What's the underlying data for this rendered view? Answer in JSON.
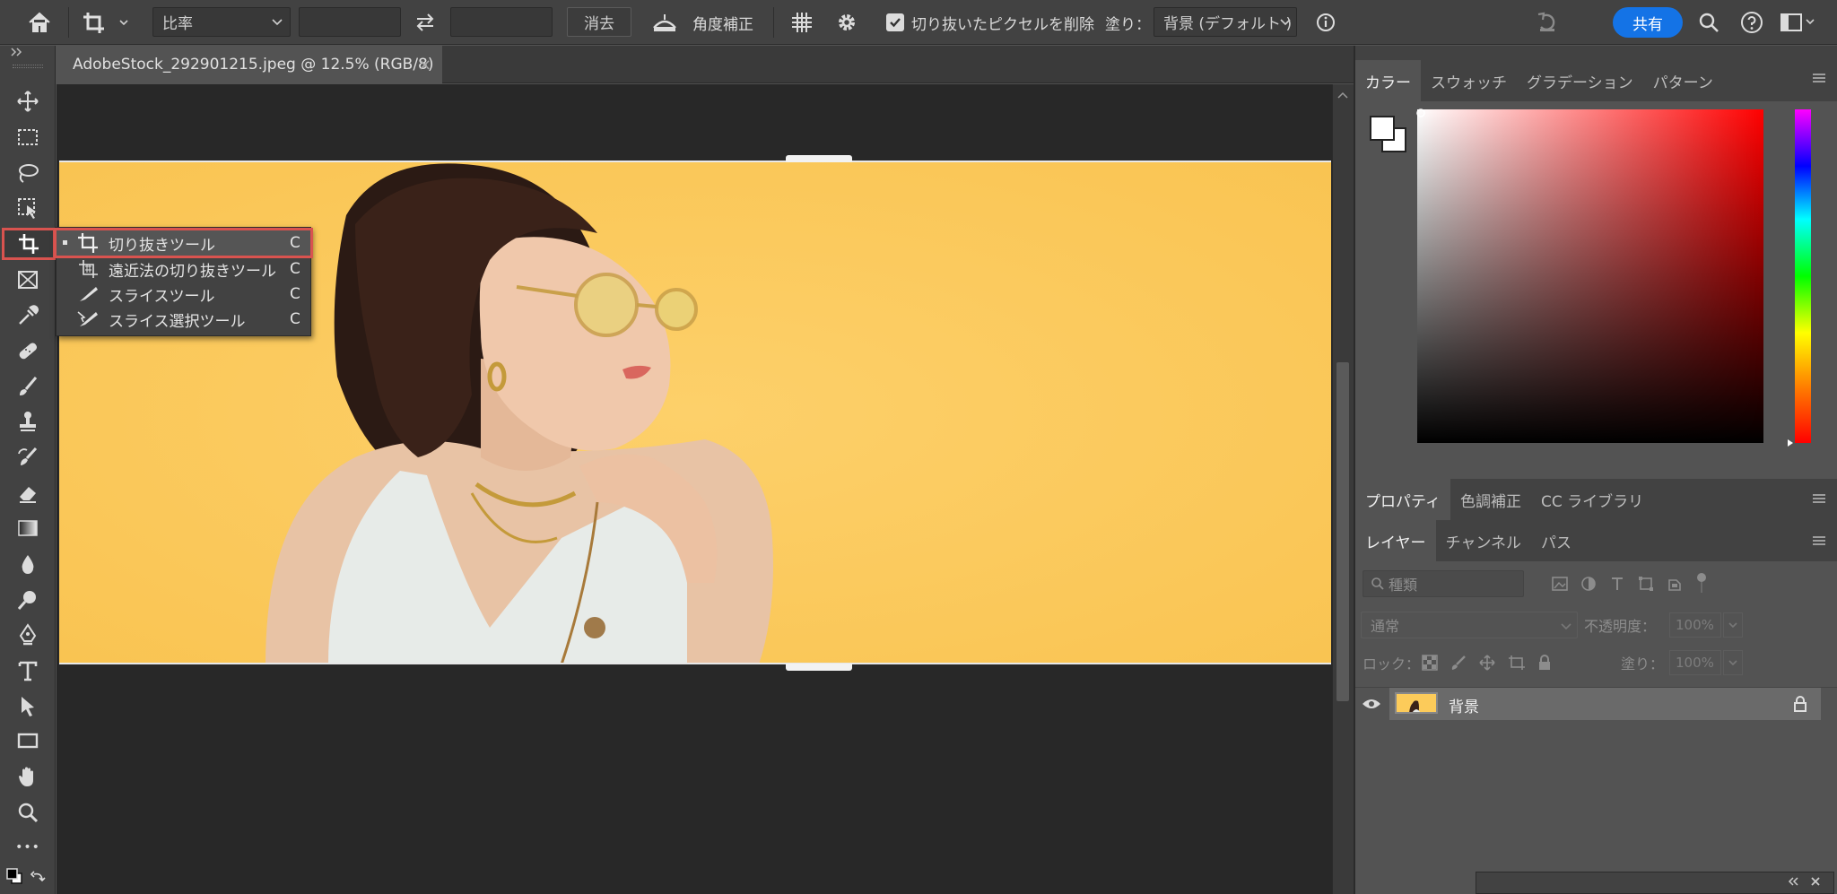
{
  "options_bar": {
    "ratio_label": "比率",
    "width_value": "",
    "height_value": "",
    "clear_label": "消去",
    "straighten_label": "角度補正",
    "delete_cropped_label": "切り抜いたピクセルを削除",
    "delete_cropped_checked": true,
    "fill_label": "塗り：",
    "fill_value": "背景 (デフォルト )",
    "share_label": "共有"
  },
  "document": {
    "tab_title": "AdobeStock_292901215.jpeg @ 12.5% (RGB/8)",
    "close_glyph": "×"
  },
  "toolbar": {
    "selected_tool": "crop-tool",
    "more_glyph": "•••"
  },
  "flyout_menu": {
    "items": [
      {
        "label": "切り抜きツール",
        "shortcut": "C",
        "selected": true
      },
      {
        "label": "遠近法の切り抜きツール",
        "shortcut": "C",
        "selected": false
      },
      {
        "label": "スライスツール",
        "shortcut": "C",
        "selected": false
      },
      {
        "label": "スライス選択ツール",
        "shortcut": "C",
        "selected": false
      }
    ]
  },
  "color_panel": {
    "tabs": [
      "カラー",
      "スウォッチ",
      "グラデーション",
      "パターン"
    ],
    "active_tab": "カラー",
    "hue_color": "#ff0000",
    "foreground": "#ffffff",
    "background": "#ffffff"
  },
  "properties_panel": {
    "tabs": [
      "プロパティ",
      "色調補正",
      "CC ライブラリ"
    ],
    "active_tab": "プロパティ"
  },
  "layers_panel": {
    "tabs": [
      "レイヤー",
      "チャンネル",
      "パス"
    ],
    "active_tab": "レイヤー",
    "filter_placeholder": "種類",
    "blend_mode": "通常",
    "opacity_label": "不透明度：",
    "opacity_value": "100%",
    "lock_label": "ロック：",
    "fill_label": "塗り：",
    "fill_value": "100%",
    "layers": [
      {
        "name": "背景",
        "visible": true,
        "locked": true
      }
    ]
  },
  "colors": {
    "canvas_yellow": "#fccb5a",
    "accent_blue": "#1473e6",
    "highlight_red": "#d9534f"
  }
}
